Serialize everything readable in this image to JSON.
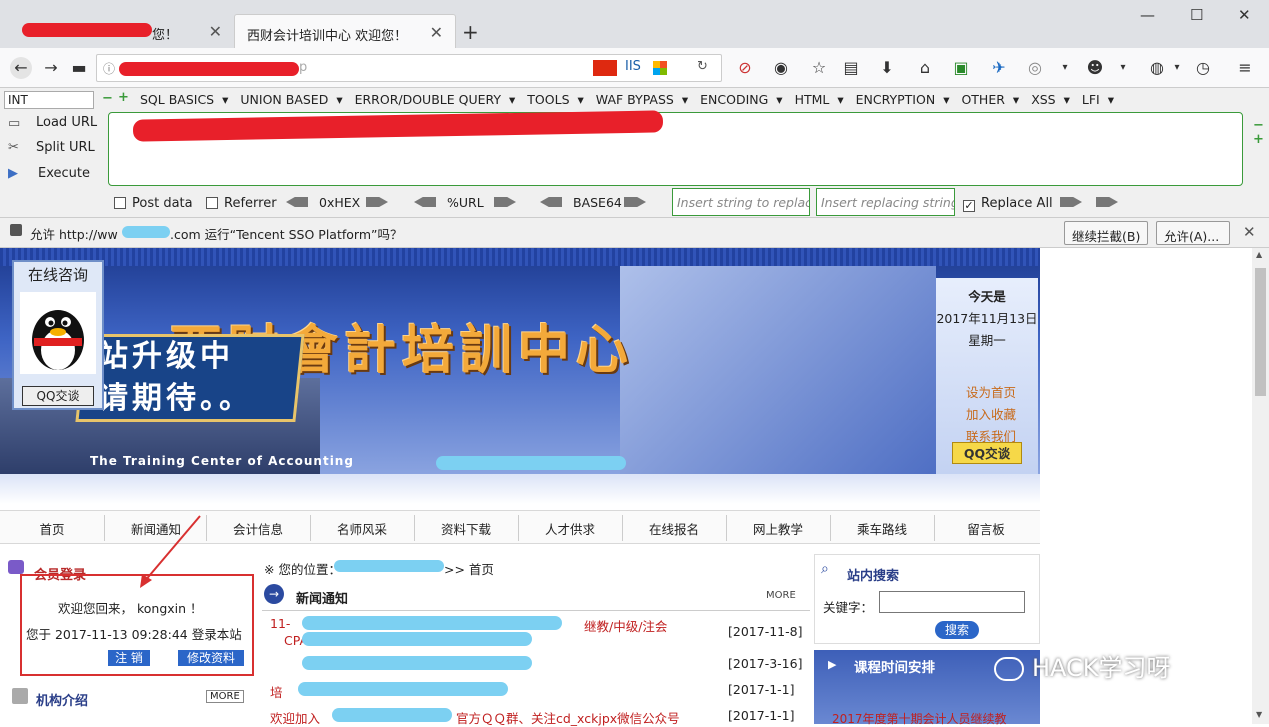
{
  "browser": {
    "tab1_title": "您！",
    "tab2_title": "西财会计培训中心 欢迎您！",
    "url_suffix": "p",
    "server_label": "IIS",
    "win_min": "—",
    "win_max": "☐",
    "win_close": "✕"
  },
  "hackbar": {
    "type_select": "INT",
    "menu": [
      "SQL BASICS",
      "UNION BASED",
      "ERROR/DOUBLE QUERY",
      "TOOLS",
      "WAF BYPASS",
      "ENCODING",
      "HTML",
      "ENCRYPTION",
      "OTHER",
      "XSS",
      "LFI"
    ],
    "load_url": "Load URL",
    "split_url": "Split URL",
    "execute": "Execute",
    "post_data": "Post data",
    "referrer": "Referrer",
    "hex": "0xHEX",
    "url_enc": "%URL",
    "base64": "BASE64",
    "insert_placeholder": "Insert string to replace",
    "replacing_placeholder": "Insert replacing string",
    "replace_all": "Replace All"
  },
  "notification": {
    "text_prefix": "允许 http://ww",
    "text_suffix": ".com 运行“Tencent SSO Platform”吗？",
    "continue_block": "继续拦截(B)",
    "allow": "允许(A)..."
  },
  "banner": {
    "title": "西财會計培訓中心",
    "sign_line1": "站升级中",
    "sign_line2": "请期待。。",
    "subtitle": "The Training Center of Accounting",
    "consult_title": "在线咨询",
    "qq_button": "QQ交谈",
    "today_label": "今天是",
    "date": "2017年11月13日",
    "weekday": "星期一",
    "links": [
      "设为首页",
      "加入收藏",
      "联系我们"
    ],
    "qq_badge": "QQ交谈"
  },
  "nav": [
    "首页",
    "新闻通知",
    "会计信息",
    "名师风采",
    "资料下载",
    "人才供求",
    "在线报名",
    "网上教学",
    "乘车路线",
    "留言板"
  ],
  "member": {
    "title": "会员登录",
    "welcome": "欢迎您回来， kongxin ！",
    "login_time": "您于 2017-11-13 09:28:44 登录本站",
    "logout": "注 销",
    "edit": "修改资料"
  },
  "agency": {
    "title": "机构介绍",
    "more": "MORE"
  },
  "news": {
    "location_label": "※ 您的位置：",
    "location_tail": ">> 首页",
    "title": "新闻通知",
    "more": "MORE",
    "rows": [
      {
        "text": "11-",
        "text2": "继教/中级/注会",
        "text3": "CPA",
        "date": "[2017-11-8]"
      },
      {
        "text": "",
        "date": "[2017-3-16]"
      },
      {
        "text": "培",
        "date": "[2017-1-1]"
      },
      {
        "text": "欢迎加入",
        "text2": "官方ＱＱ群、关注cd_xckjpx微信公众号",
        "date": "[2017-1-1]"
      }
    ]
  },
  "search": {
    "title": "站内搜索",
    "keyword_label": "关键字：",
    "button": "搜索"
  },
  "schedule": {
    "title": "课程时间安排",
    "line": "2017年度第十期会计人员继续教"
  },
  "watermark": "HACK学习呀"
}
